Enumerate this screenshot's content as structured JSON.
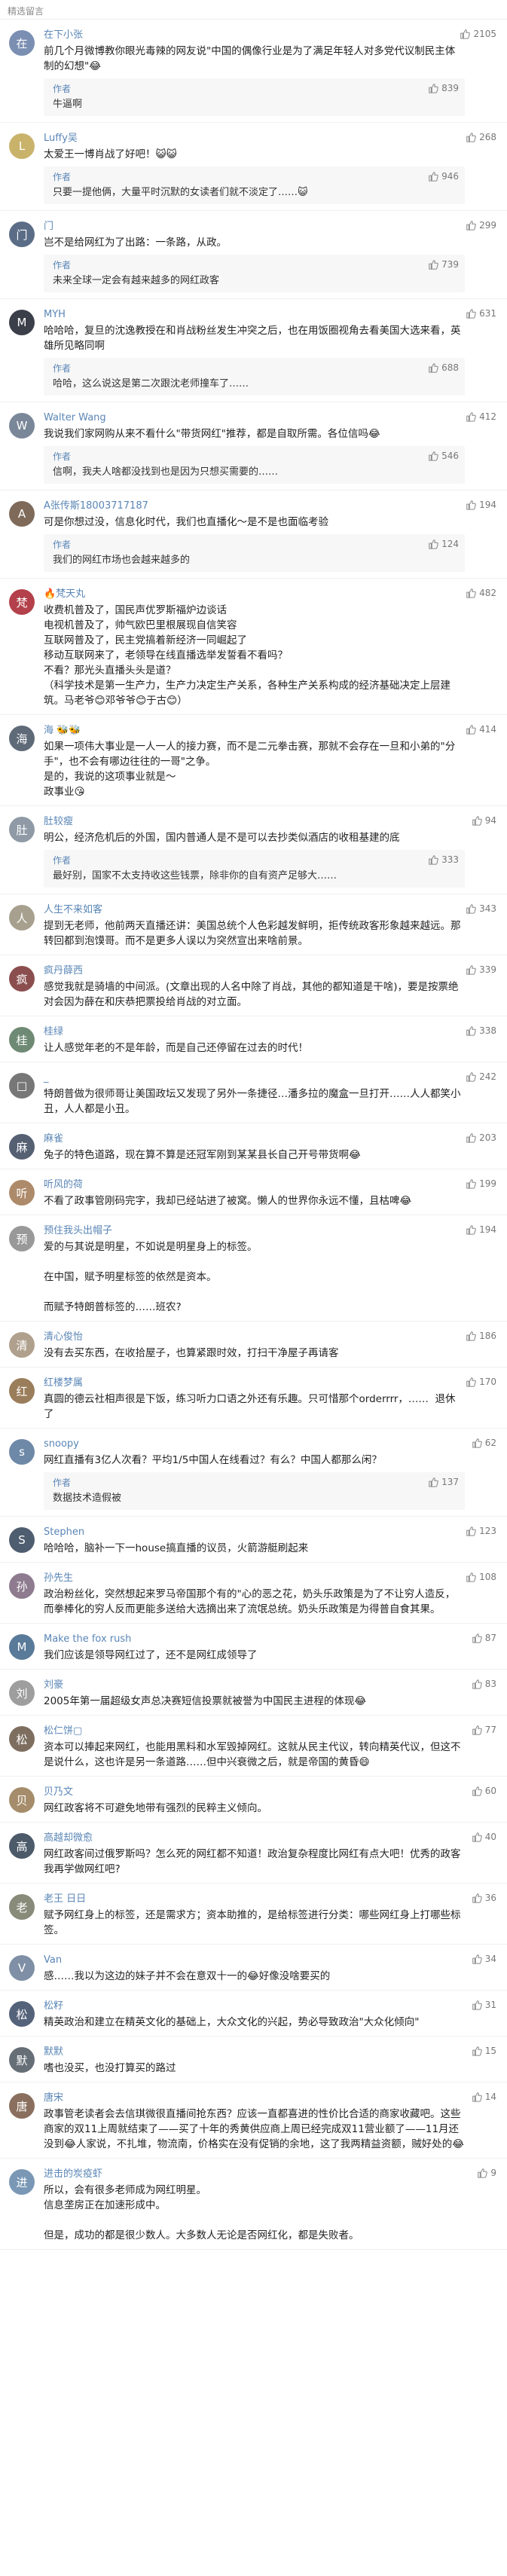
{
  "header": {
    "title": "精选留言"
  },
  "comments": [
    {
      "avatar_color": "#7b8fb3",
      "avatar_char": "在",
      "name": "在下小张",
      "likes": "2105",
      "text": "前几个月微博教你眼光毒辣的网友说\"中国的偶像行业是为了满足年轻人对多党代议制民主体制的幻想\"😂",
      "reply": {
        "name": "作者",
        "text": "牛逼啊",
        "likes": "839"
      }
    },
    {
      "avatar_color": "#c9b36b",
      "avatar_char": "L",
      "name": "Luffy吴",
      "likes": "268",
      "text": "太爱王一博肖战了好吧！😺😺",
      "reply": {
        "name": "作者",
        "text": "只要一提他俩，大量平时沉默的女读者们就不淡定了……😺",
        "likes": "946"
      }
    },
    {
      "avatar_color": "#5b6d86",
      "avatar_char": "门",
      "name": "门",
      "likes": "299",
      "text": "岂不是给网红为了出路：一条路，从政。",
      "reply": {
        "name": "作者",
        "text": "未来全球一定会有越来越多的网红政客",
        "likes": "739"
      }
    },
    {
      "avatar_color": "#3b3f4a",
      "avatar_char": "M",
      "name": "MYH",
      "likes": "631",
      "text": "哈哈哈，复旦的沈逸教授在和肖战粉丝发生冲突之后，也在用饭圈视角去看美国大选来看，英雄所见略同啊",
      "reply": {
        "name": "作者",
        "text": "哈哈，这么说这是第二次跟沈老师撞车了……",
        "likes": "688"
      }
    },
    {
      "avatar_color": "#7a8799",
      "avatar_char": "W",
      "name": "Walter Wang",
      "likes": "412",
      "text": "我说我们家网购从来不看什么\"带货网红\"推荐，都是自取所需。各位信吗😂",
      "reply": {
        "name": "作者",
        "text": "信啊，我夫人啥都没找到也是因为只想买需要的……",
        "likes": "546"
      }
    },
    {
      "avatar_color": "#7f6a5a",
      "avatar_char": "A",
      "name": "A张传斯18003717187",
      "likes": "194",
      "text": "可是你想过没，信息化时代，我们也直播化～是不是也面临考验",
      "reply": {
        "name": "作者",
        "text": "我们的网红市场也会越来越多的",
        "likes": "124"
      }
    },
    {
      "avatar_color": "#b3404a",
      "avatar_char": "梵",
      "name": "🔥梵天丸",
      "likes": "482",
      "text": "收费机普及了，国民声优罗斯福炉边谈话\n电视机普及了，帅气欧巴里根展现自信笑容\n互联网普及了，民主党搞着新经济一同崛起了\n移动互联网来了，老领导在线直播选举发誓看不看吗？\n不看？那光头直播头头是道？\n（科学技术是第一生产力，生产力决定生产关系，各种生产关系构成的经济基础决定上层建筑。马老爷😊邓爷爷😊于古😊）",
      "reply": null
    },
    {
      "avatar_color": "#5f6a78",
      "avatar_char": "海",
      "name": "海 🐝🐝",
      "likes": "414",
      "text": "如果一项伟大事业是一人一人的接力赛，而不是二元拳击赛，那就不会存在一旦和小弟的\"分手\"，也不会有哪边往往的一哥\"之争。\n是的，我说的这项事业就是～\n政事业😘",
      "reply": null
    },
    {
      "avatar_color": "#8f9aa6",
      "avatar_char": "肚",
      "name": "肚较瘦",
      "likes": "94",
      "text": "明公，经济危机后的外国，国内普通人是不是可以去抄类似酒店的收租基建的底",
      "reply": {
        "name": "作者",
        "text": "最好别，国家不太支持收这些钱票，除非你的自有资产足够大……",
        "likes": "333"
      }
    },
    {
      "avatar_color": "#a7a08e",
      "avatar_char": "人",
      "name": "人生不来如客",
      "likes": "343",
      "text": "提到无老师，他前两天直播还讲：美国总统个人色彩越发鲜明，拒传统政客形象越来越远。那转回都到泡馍哥。而不是更多人误以为突然宣出来啥前景。",
      "reply": null
    },
    {
      "avatar_color": "#8b4e4e",
      "avatar_char": "疯",
      "name": "疯丹薛西",
      "likes": "339",
      "text": "感觉我就是骑墙的中间派。(文章出现的人名中除了肖战，其他的都知道是干啥)，要是按票绝对会因为薛在和庆恭把票投给肖战的对立面。",
      "reply": null
    },
    {
      "avatar_color": "#6f8a74",
      "avatar_char": "桂",
      "name": "桂绿",
      "likes": "338",
      "text": "让人感觉年老的不是年龄，而是自己还停留在过去的时代！",
      "reply": null
    },
    {
      "avatar_color": "#777777",
      "avatar_char": "□",
      "name": "_",
      "likes": "242",
      "text": "特朗普做为很师哥让美国政坛又发现了另外一条捷径…潘多拉的魔盒一旦打开……人人都笑小丑，人人都是小丑。",
      "reply": null
    },
    {
      "avatar_color": "#556073",
      "avatar_char": "麻",
      "name": "麻雀",
      "likes": "203",
      "text": "兔子的特色道路，现在算不算是还冠军刚到某某县长自己开号带货啊😂",
      "reply": null
    },
    {
      "avatar_color": "#ad8a6a",
      "avatar_char": "听",
      "name": "听风的荷",
      "likes": "199",
      "text": "不看了政事管刚码完字，我却已经站进了被窝。懒人的世界你永远不懂，且枯啤😂",
      "reply": null
    },
    {
      "avatar_color": "#999999",
      "avatar_char": "预",
      "name": "预住我头出帽子",
      "likes": "194",
      "text": "爱的与其说是明星，不如说是明星身上的标签。\n\n在中国，赋予明星标签的依然是资本。\n\n而赋予特朗普标签的……班农?",
      "reply": null
    },
    {
      "avatar_color": "#b0a08e",
      "avatar_char": "清",
      "name": "清心俊怡",
      "likes": "186",
      "text": "没有去买东西，在收拾屋子，也算紧跟时效，打扫干净屋子再请客",
      "reply": null
    },
    {
      "avatar_color": "#9a7d5a",
      "avatar_char": "红",
      "name": "红楼梦属",
      "likes": "170",
      "text": "真圆的德云社相声很是下饭，练习听力口语之外还有乐趣。只可惜那个orderrrr，……  退休了",
      "reply": null
    },
    {
      "avatar_color": "#6e88a8",
      "avatar_char": "s",
      "name": "snoopy",
      "likes": "62",
      "text": "网红直播有3亿人次看？平均1/5中国人在线看过？有么？中国人都那么闲？",
      "reply": {
        "name": "作者",
        "text": "数据技术造假被",
        "likes": "137"
      }
    },
    {
      "avatar_color": "#4f5d70",
      "avatar_char": "S",
      "name": "Stephen",
      "likes": "123",
      "text": "哈哈哈，脑补一下一house搞直播的议员，火箭游艇刷起来",
      "reply": null
    },
    {
      "avatar_color": "#8e7b8f",
      "avatar_char": "孙",
      "name": "孙先生",
      "likes": "108",
      "text": "政治粉丝化，突然想起来罗马帝国那个有的\"心的恶之花，奶头乐政策是为了不让穷人造反，而拳棒化的穷人反而更能多送给大选摘出来了流氓总统。奶头乐政策是为得普自食其果。",
      "reply": null
    },
    {
      "avatar_color": "#5a7a99",
      "avatar_char": "M",
      "name": "Make the fox rush",
      "likes": "87",
      "text": "我们应该是领导网红过了，还不是网红成领导了",
      "reply": null
    },
    {
      "avatar_color": "#9e9e9e",
      "avatar_char": "刘",
      "name": "刘豪",
      "likes": "83",
      "text": "2005年第一届超级女声总决赛短信投票就被誉为中国民主进程的体现😂",
      "reply": null
    },
    {
      "avatar_color": "#7d6e5f",
      "avatar_char": "松",
      "name": "松仁饼▢",
      "likes": "77",
      "text": "资本可以捧起来网红，也能用黑料和水军毁掉网红。这就从民主代议，转向精英代议，但这不是说什么，这也许是另一条道路……但中兴衰微之后，就是帝国的黄昏😄",
      "reply": null
    },
    {
      "avatar_color": "#a58d6b",
      "avatar_char": "贝",
      "name": "贝乃文",
      "likes": "60",
      "text": "网红政客将不可避免地带有强烈的民粹主义倾向。",
      "reply": null
    },
    {
      "avatar_color": "#4c5a6a",
      "avatar_char": "高",
      "name": "高越却微愈",
      "likes": "40",
      "text": "网红政客间过俄罗斯吗？怎么死的网红都不知道！政治复杂程度比网红有点大吧！优秀的政客我再学做网红吧?",
      "reply": null
    },
    {
      "avatar_color": "#888a7a",
      "avatar_char": "老",
      "name": "老王 日日",
      "likes": "36",
      "text": "赋予网红身上的标签，还是需求方；资本助推的，是给标签进行分类：哪些网红身上打哪些标签。",
      "reply": null
    },
    {
      "avatar_color": "#7f8fa5",
      "avatar_char": "V",
      "name": "Van",
      "likes": "34",
      "text": "感……我以为这边的妹子并不会在意双十一的😂好像没啥要买的",
      "reply": null
    },
    {
      "avatar_color": "#54627a",
      "avatar_char": "松",
      "name": "松籽",
      "likes": "31",
      "text": "精英政治和建立在精英文化的基础上，大众文化的兴起，势必导致政治\"大众化倾向\"",
      "reply": null
    },
    {
      "avatar_color": "#666e76",
      "avatar_char": "默",
      "name": "默默",
      "likes": "15",
      "text": "嗜也没买，也没打算买的路过",
      "reply": null
    },
    {
      "avatar_color": "#8a6f5e",
      "avatar_char": "唐",
      "name": "唐宋",
      "likes": "14",
      "text": "政事管老读者会去信琪微很直播间抢东西？应该一直都喜进的性价比合适的商家收藏吧。这些商家的双11上周就结束了——买了十年的秀黄供应商上周已经完成双11营业额了——11月还没到😂人家说，不扎堆，物流南，价格实在没有促销的余地，这了我两精益资额，贼好处的😂",
      "reply": null
    },
    {
      "avatar_color": "#7a98b5",
      "avatar_char": "进",
      "name": "进击的炭疫虾",
      "likes": "9",
      "text": "所以，会有很多老师成为网红明星。\n信息垄房正在加速形成中。\n\n但是，成功的都是很少数人。大多数人无论是否网红化，都是失败者。",
      "reply": null
    }
  ]
}
